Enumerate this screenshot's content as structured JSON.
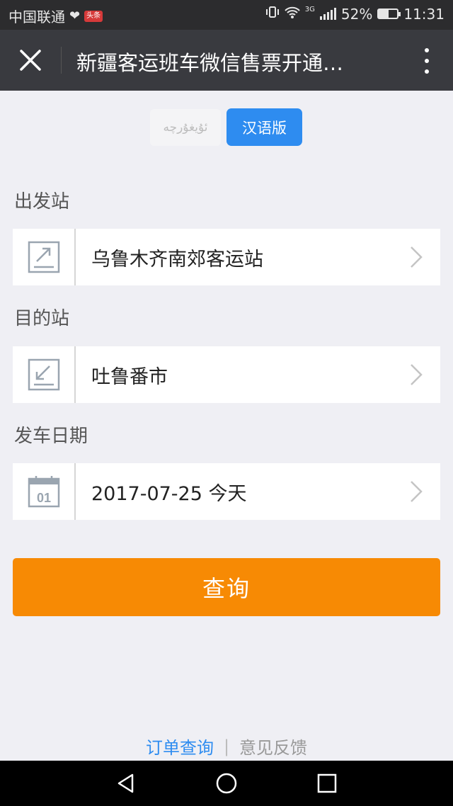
{
  "status_bar": {
    "carrier": "中国联通",
    "toutiao_badge": "头条",
    "network": "3G",
    "battery": "52%",
    "battery_level": 0.52,
    "time": "11:31"
  },
  "title_bar": {
    "title": "新疆客运班车微信售票开通…"
  },
  "language": {
    "uyghur_label": "ئۇيغۇرچە",
    "chinese_label": "汉语版",
    "active": "chinese",
    "active_color": "#2e8cf0"
  },
  "form": {
    "departure": {
      "label": "出发站",
      "value": "乌鲁木齐南郊客运站",
      "icon": "depart-arrow-icon"
    },
    "destination": {
      "label": "目的站",
      "value": "吐鲁番市",
      "icon": "arrive-arrow-icon"
    },
    "date": {
      "label": "发车日期",
      "value": "2017-07-25 今天",
      "icon": "calendar-icon",
      "calendar_number": "01"
    }
  },
  "query_button": {
    "label": "查询",
    "color": "#f78a04"
  },
  "footer": {
    "orders_link": "订单查询",
    "separator": "|",
    "feedback_link": "意见反馈"
  }
}
